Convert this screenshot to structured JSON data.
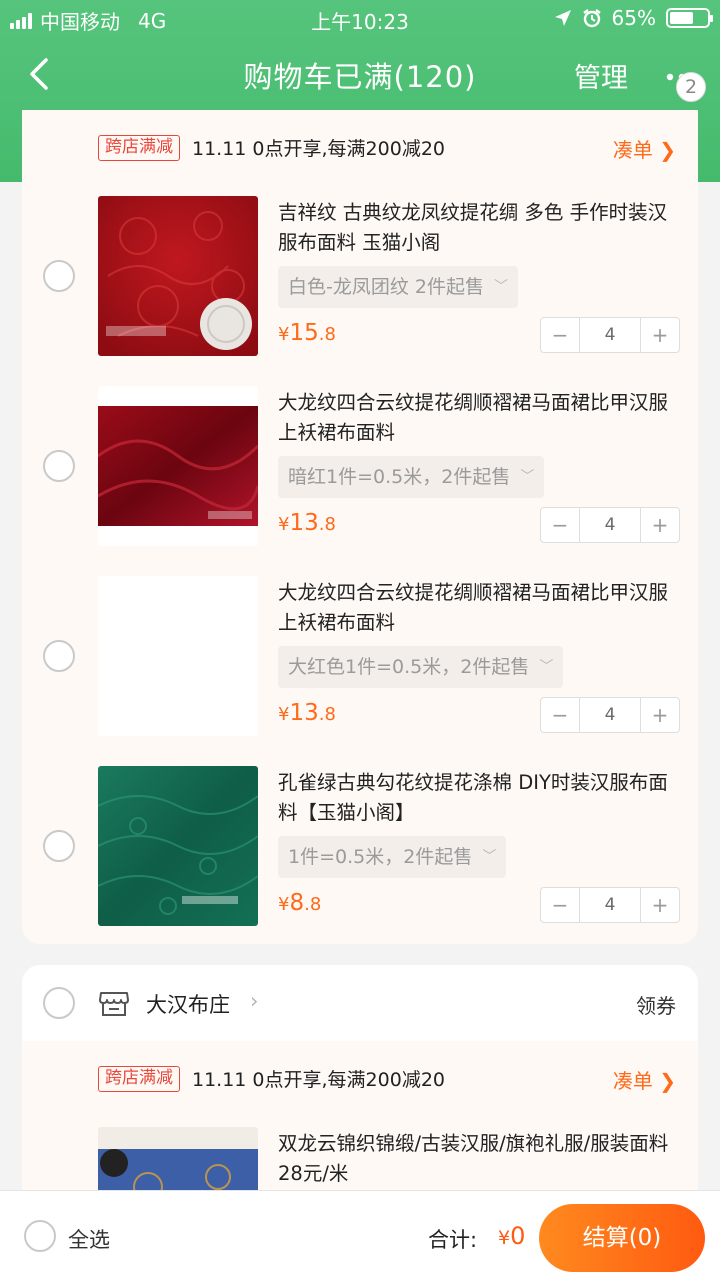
{
  "status_bar": {
    "carrier": "中国移动",
    "network": "4G",
    "time": "上午10:23",
    "battery": "65%",
    "battery_level": 0.65
  },
  "nav": {
    "title": "购物车已满(120)",
    "manage": "管理",
    "badge": "2"
  },
  "promo": {
    "tag": "跨店满减",
    "text": "11.11 0点开享,每满200减20",
    "link": "凑单 ❯"
  },
  "items": [
    {
      "title": "吉祥纹 古典纹龙凤纹提花绸 多色 手作时装汉服布面料 玉猫小阁",
      "sku": "白色-龙凤团纹 2件起售",
      "price_symbol": "¥",
      "price_int": "15",
      "price_dec": ".8",
      "quantity": "4"
    },
    {
      "title": "大龙纹四合云纹提花绸顺褶裙马面裙比甲汉服上袄裙布面料",
      "sku": "暗红1件=0.5米，2件起售",
      "price_symbol": "¥",
      "price_int": "13",
      "price_dec": ".8",
      "quantity": "4"
    },
    {
      "title": "大龙纹四合云纹提花绸顺褶裙马面裙比甲汉服上袄裙布面料",
      "sku": "大红色1件=0.5米，2件起售",
      "price_symbol": "¥",
      "price_int": "13",
      "price_dec": ".8",
      "quantity": "4"
    },
    {
      "title": "孔雀绿古典勾花纹提花涤棉  DIY时装汉服布面料【玉猫小阁】",
      "sku": "1件=0.5米，2件起售",
      "price_symbol": "¥",
      "price_int": "8",
      "price_dec": ".8",
      "quantity": "4"
    }
  ],
  "shop2": {
    "name": "大汉布庄",
    "coupon": "领券",
    "promo": {
      "tag": "跨店满减",
      "text": "11.11 0点开享,每满200减20",
      "link": "凑单 ❯"
    },
    "item": {
      "title": "双龙云锦织锦缎/古装汉服/旗袍礼服/服装面料 28元/米"
    }
  },
  "bottom": {
    "select_all": "全选",
    "total_label": "合计:",
    "total_symbol": "¥",
    "total_value": "0",
    "checkout": "结算(0)"
  },
  "colors": {
    "brand_green": "#4cbf74",
    "accent_orange": "#ff6a1a",
    "promo_red": "#e8483b"
  },
  "steppers": {
    "minus": "−",
    "plus": "+"
  }
}
